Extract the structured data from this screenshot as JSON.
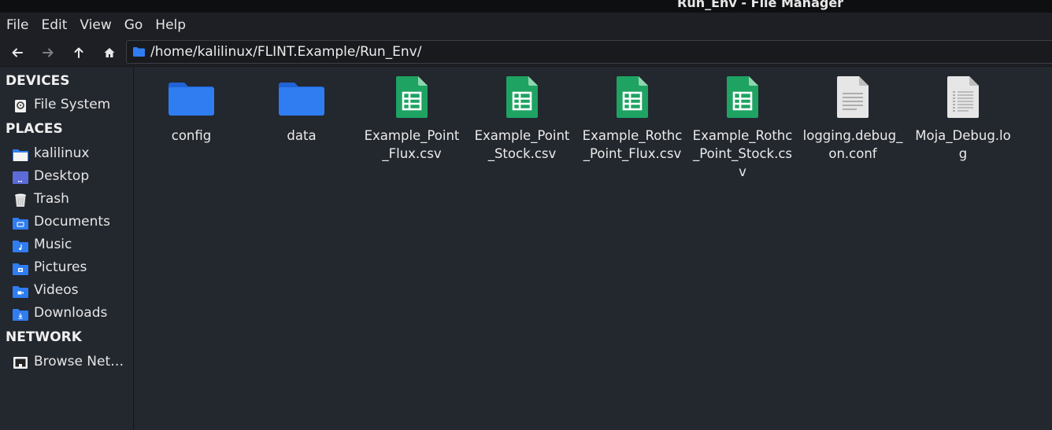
{
  "window": {
    "title": "Run_Env - File Manager"
  },
  "menubar": {
    "items": [
      "File",
      "Edit",
      "View",
      "Go",
      "Help"
    ]
  },
  "toolbar": {
    "back_icon": "arrow-left-icon",
    "forward_icon": "arrow-right-icon",
    "up_icon": "arrow-up-icon",
    "home_icon": "home-icon",
    "path": "/home/kalilinux/FLINT.Example/Run_Env/"
  },
  "sidebar": {
    "devices_heading": "DEVICES",
    "devices": [
      {
        "label": "File System",
        "icon": "hard-drive-icon"
      }
    ],
    "places_heading": "PLACES",
    "places": [
      {
        "label": "kalilinux",
        "icon": "home-folder-icon"
      },
      {
        "label": "Desktop",
        "icon": "desktop-icon"
      },
      {
        "label": "Trash",
        "icon": "trash-icon"
      },
      {
        "label": "Documents",
        "icon": "documents-folder-icon"
      },
      {
        "label": "Music",
        "icon": "music-folder-icon"
      },
      {
        "label": "Pictures",
        "icon": "pictures-folder-icon"
      },
      {
        "label": "Videos",
        "icon": "videos-folder-icon"
      },
      {
        "label": "Downloads",
        "icon": "downloads-folder-icon"
      }
    ],
    "network_heading": "NETWORK",
    "network": [
      {
        "label": "Browse Net…",
        "icon": "network-icon"
      }
    ]
  },
  "files": [
    {
      "name": "config",
      "type": "folder"
    },
    {
      "name": "data",
      "type": "folder"
    },
    {
      "name": "Example_Point_Flux.csv",
      "type": "spreadsheet"
    },
    {
      "name": "Example_Point_Stock.csv",
      "type": "spreadsheet"
    },
    {
      "name": "Example_Rothc_Point_Flux.csv",
      "type": "spreadsheet"
    },
    {
      "name": "Example_Rothc_Point_Stock.csv",
      "type": "spreadsheet"
    },
    {
      "name": "logging.debug_on.conf",
      "type": "text"
    },
    {
      "name": "Moja_Debug.log",
      "type": "log"
    }
  ],
  "colors": {
    "background": "#23272e",
    "folder_blue": "#2f7df1",
    "spreadsheet_green": "#1ea362",
    "document_gray": "#e4e4e4"
  }
}
